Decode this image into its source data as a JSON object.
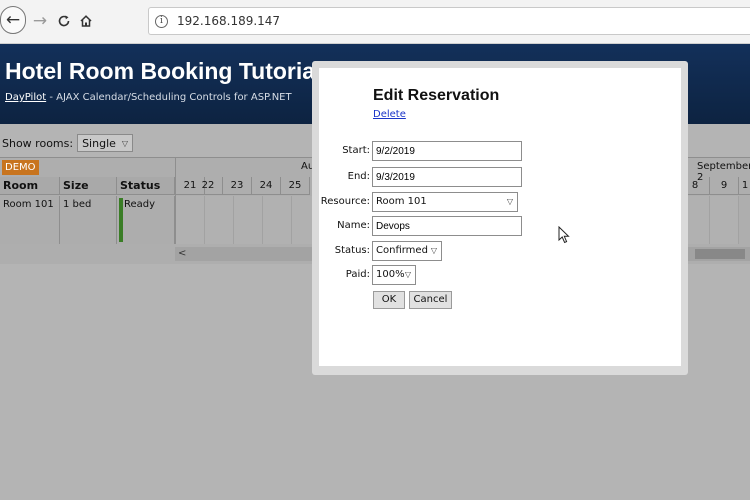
{
  "browser": {
    "url": "192.168.189.147",
    "icons": [
      "back-arrow",
      "forward-arrow",
      "reload",
      "home",
      "info"
    ]
  },
  "header": {
    "title": "Hotel Room Booking Tutorial",
    "subtitle_link": "DayPilot",
    "subtitle_rest": " - AJAX Calendar/Scheduling Controls for ASP.NET"
  },
  "filter": {
    "label": "Show rooms:",
    "selected": "Single"
  },
  "scheduler": {
    "badge": "DEMO",
    "columns": [
      "Room",
      "Size",
      "Status"
    ],
    "rows": [
      {
        "room": "Room 101",
        "size": "1 bed",
        "status": "Ready"
      }
    ],
    "month_left": "Au",
    "month_right": "September 2",
    "days_left": [
      "21",
      "22",
      "23",
      "24",
      "25"
    ],
    "days_right": [
      "8",
      "9",
      "1"
    ],
    "scroll_left": "<"
  },
  "dialog": {
    "title": "Edit Reservation",
    "delete_label": "Delete",
    "start_label": "Start:",
    "start_value": "9/2/2019",
    "end_label": "End:",
    "end_value": "9/3/2019",
    "resource_label": "Resource:",
    "resource_value": "Room 101",
    "name_label": "Name:",
    "name_value": "Devops",
    "status_label": "Status:",
    "status_value": "Confirmed",
    "paid_label": "Paid:",
    "paid_value": "100%",
    "ok_label": "OK",
    "cancel_label": "Cancel"
  },
  "colors": {
    "header_bg": "#13305a",
    "demo_badge": "#c8741e",
    "status_ready": "#3a7d26",
    "link": "#1a34c8"
  }
}
